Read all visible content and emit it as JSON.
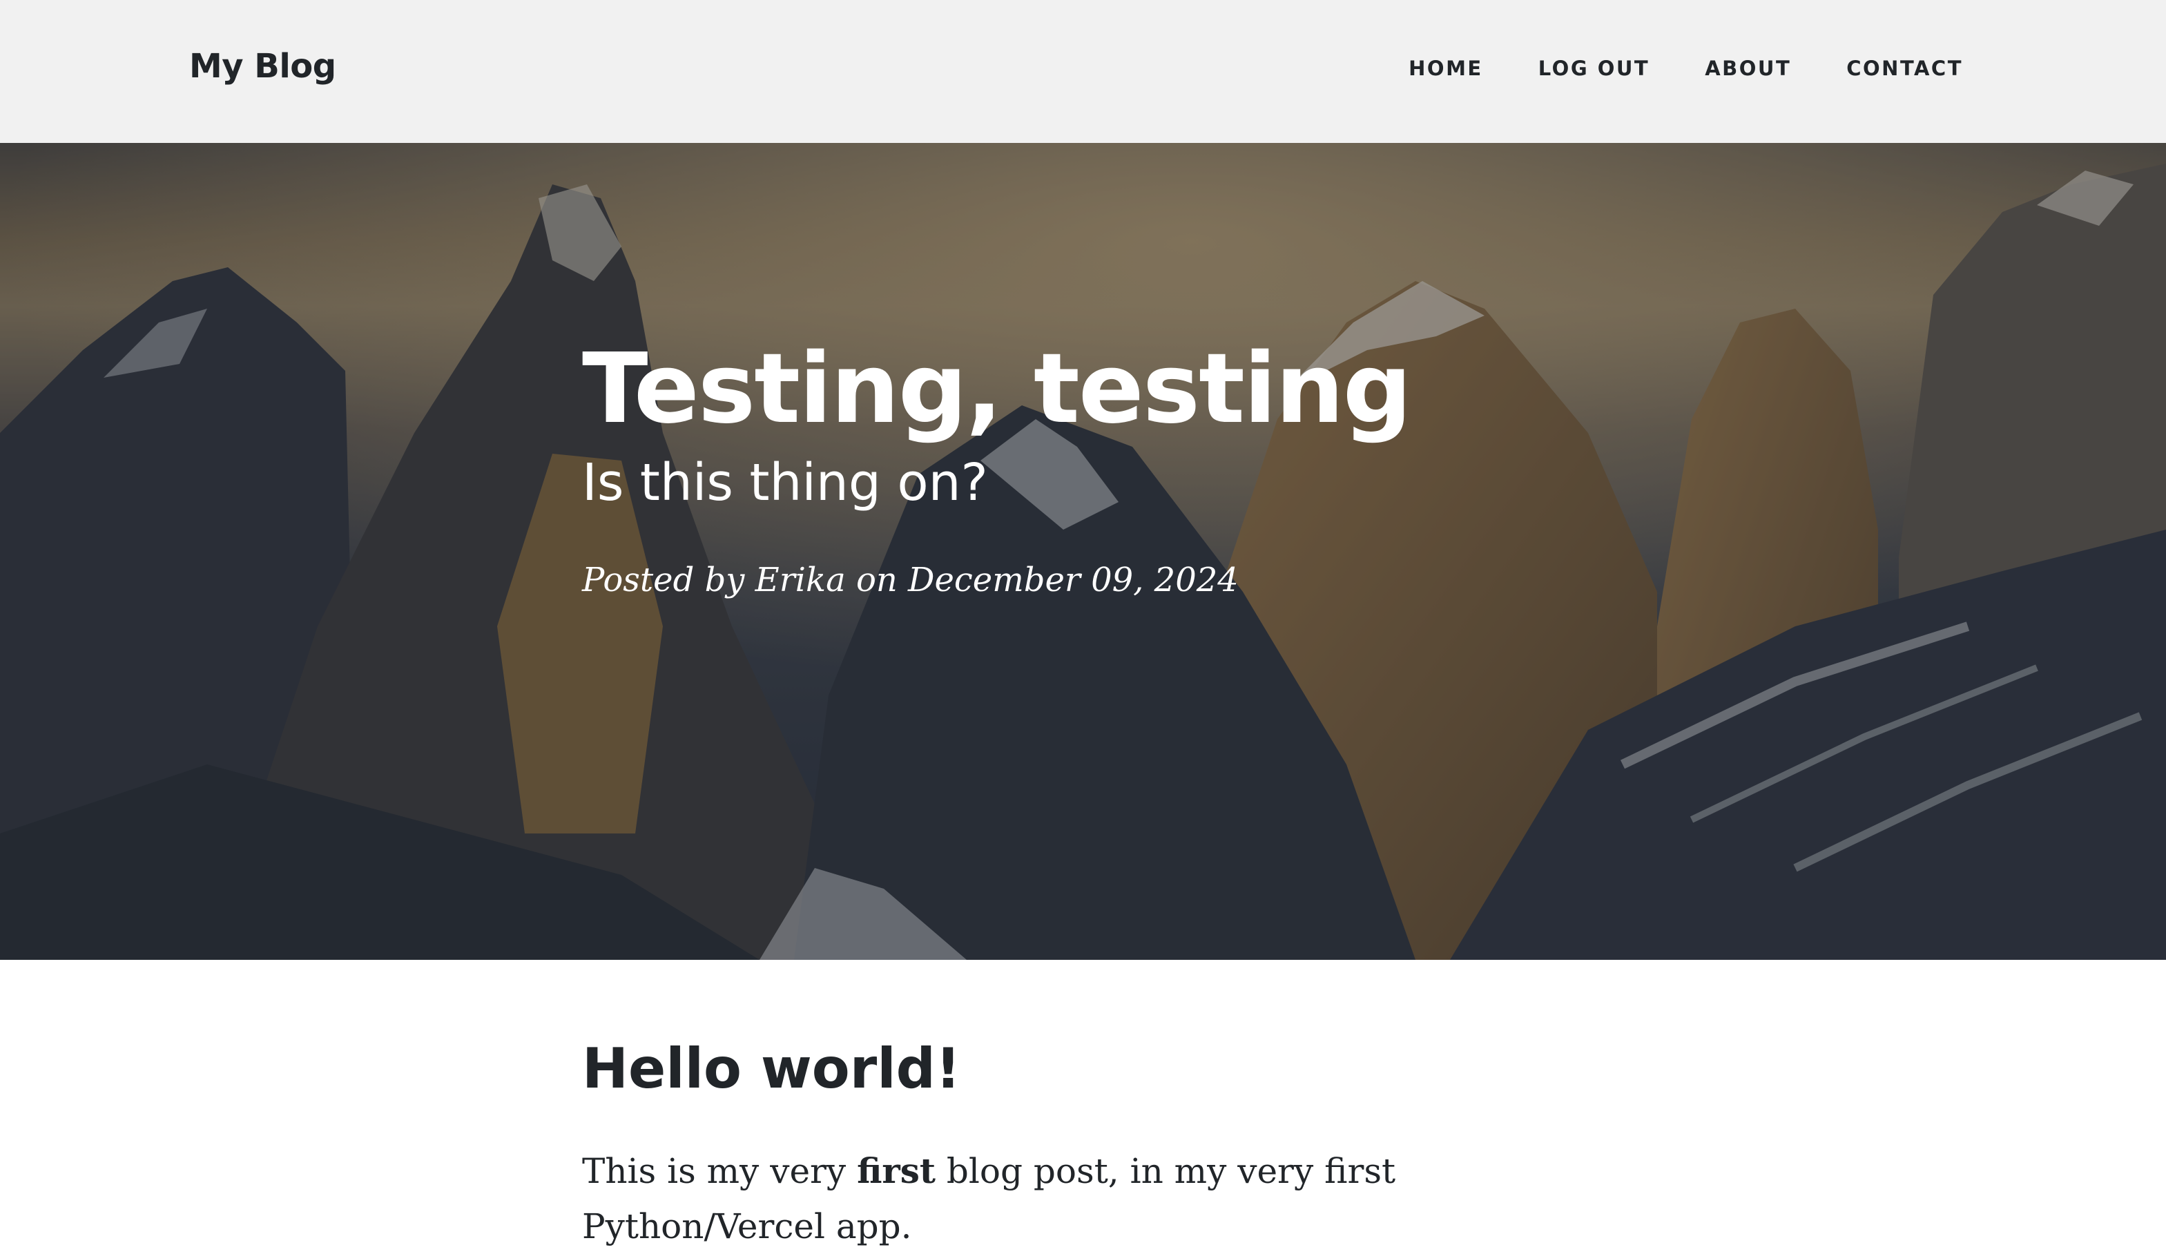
{
  "navbar": {
    "brand": "My Blog",
    "links": [
      "HOME",
      "LOG OUT",
      "ABOUT",
      "CONTACT"
    ]
  },
  "hero": {
    "title": "Testing, testing",
    "subtitle": "Is this thing on?",
    "meta": "Posted by Erika on December 09, 2024"
  },
  "post": {
    "heading": "Hello world!",
    "body_before": "This is my very ",
    "body_bold": "first",
    "body_after": " blog post, in my very first Python/Vercel app."
  }
}
